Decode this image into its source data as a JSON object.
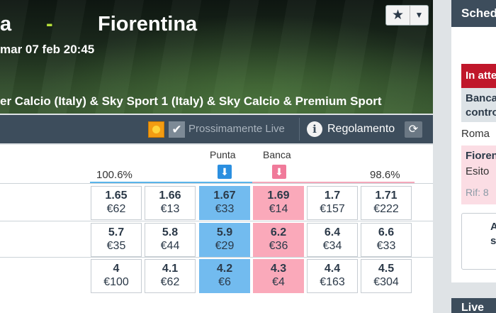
{
  "event": {
    "home_partial": "a",
    "separator": "-",
    "away": "Fiorentina",
    "datetime": "mar 07 feb 20:45",
    "tv_channels": "er Calcio (Italy) & Sky Sport 1 (Italy) & Sky Calcio & Premium Sport"
  },
  "favourite": {
    "icon": "star-icon",
    "menu_icon": "caret-down-icon"
  },
  "toolbar": {
    "live_label": "Prossimamente Live",
    "rules_label": "Regolamento",
    "info_glyph": "i",
    "icons": [
      "sun-icon",
      "checkbox-icon",
      "info-icon",
      "refresh-icon"
    ]
  },
  "market": {
    "back_label": "Punta",
    "lay_label": "Banca",
    "back_pct": "100.6%",
    "lay_pct": "98.6%",
    "rows": [
      {
        "cells": [
          {
            "odd": "1.65",
            "amount": "€62",
            "type": "neutral"
          },
          {
            "odd": "1.66",
            "amount": "€13",
            "type": "neutral"
          },
          {
            "odd": "1.67",
            "amount": "€33",
            "type": "back"
          },
          {
            "odd": "1.69",
            "amount": "€14",
            "type": "lay"
          },
          {
            "odd": "1.7",
            "amount": "€157",
            "type": "neutral"
          },
          {
            "odd": "1.71",
            "amount": "€222",
            "type": "neutral"
          }
        ]
      },
      {
        "cells": [
          {
            "odd": "5.7",
            "amount": "€35",
            "type": "neutral"
          },
          {
            "odd": "5.8",
            "amount": "€44",
            "type": "neutral"
          },
          {
            "odd": "5.9",
            "amount": "€29",
            "type": "back"
          },
          {
            "odd": "6.2",
            "amount": "€36",
            "type": "lay"
          },
          {
            "odd": "6.4",
            "amount": "€34",
            "type": "neutral"
          },
          {
            "odd": "6.6",
            "amount": "€33",
            "type": "neutral"
          }
        ]
      },
      {
        "cells": [
          {
            "odd": "4",
            "amount": "€100",
            "type": "neutral"
          },
          {
            "odd": "4.1",
            "amount": "€62",
            "type": "neutral"
          },
          {
            "odd": "4.2",
            "amount": "€6",
            "type": "back"
          },
          {
            "odd": "4.3",
            "amount": "€4",
            "type": "lay"
          },
          {
            "odd": "4.4",
            "amount": "€163",
            "type": "neutral"
          },
          {
            "odd": "4.5",
            "amount": "€304",
            "type": "neutral"
          }
        ]
      }
    ]
  },
  "right_panel": {
    "header": "Schedina",
    "pending": "In attesa",
    "cancel_line1": "Banca",
    "cancel_line2": "contro",
    "match": "Roma",
    "bet_name": "Fiorentina",
    "bet_outcome": "Esito",
    "ref": "Rif: 8",
    "button_line1": "A",
    "button_line2": "s",
    "live_header": "Live"
  },
  "colors": {
    "toolbar": "#3d4d5c",
    "back": "#72bbef",
    "lay": "#faa9ba",
    "pending": "#c0172b",
    "separator_accent": "#b5e03a"
  }
}
